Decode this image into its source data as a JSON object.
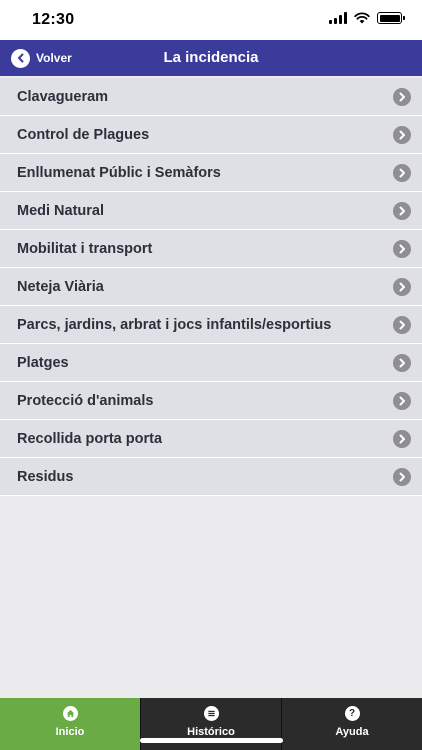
{
  "status": {
    "time": "12:30"
  },
  "nav": {
    "back_label": "Volver",
    "title": "La incidencia"
  },
  "categories": [
    {
      "label": "Clavagueram"
    },
    {
      "label": "Control de Plagues"
    },
    {
      "label": "Enllumenat Públic i Semàfors"
    },
    {
      "label": "Medi Natural"
    },
    {
      "label": "Mobilitat i transport"
    },
    {
      "label": "Neteja Viària"
    },
    {
      "label": "Parcs, jardins, arbrat i jocs infantils/esportius"
    },
    {
      "label": "Platges"
    },
    {
      "label": "Protecció d'animals"
    },
    {
      "label": "Recollida porta porta"
    },
    {
      "label": "Residus"
    }
  ],
  "tabs": [
    {
      "label": "Inicio",
      "icon": "home-icon",
      "active": true
    },
    {
      "label": "Histórico",
      "icon": "list-icon",
      "active": false
    },
    {
      "label": "Ayuda",
      "icon": "help-icon",
      "active": false
    }
  ],
  "colors": {
    "nav_bar": "#3b3b9c",
    "list_background": "#dfdfe6",
    "active_tab": "#6aab45",
    "tab_bar": "#2b2b2b"
  }
}
